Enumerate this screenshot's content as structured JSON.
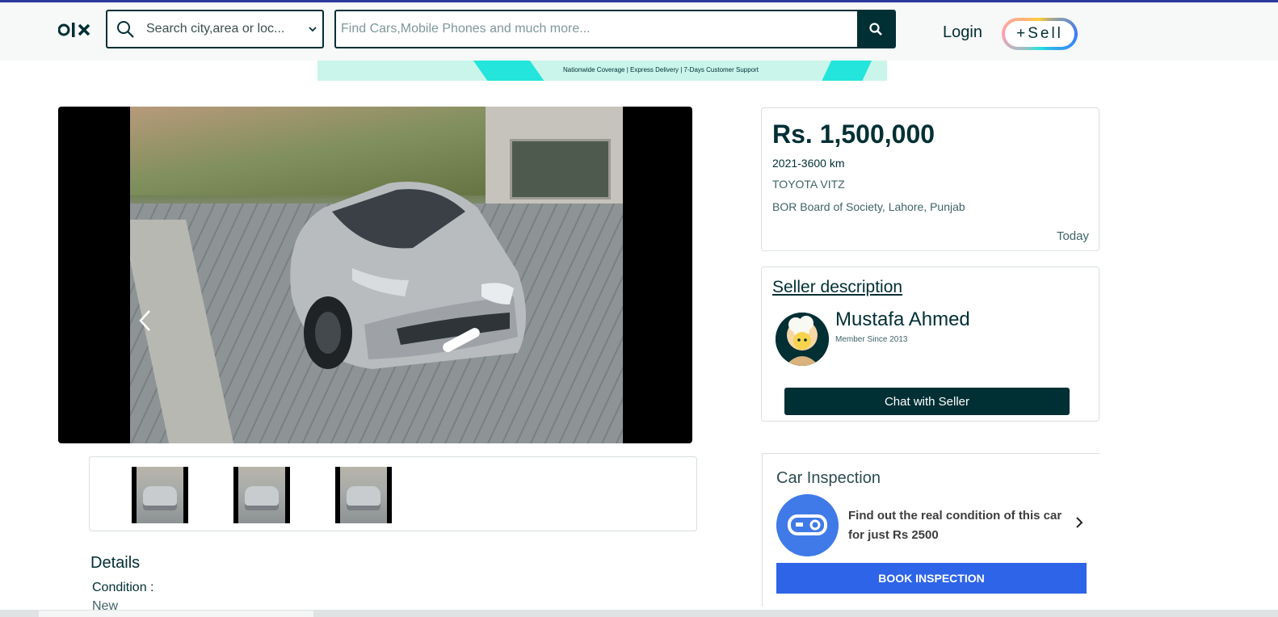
{
  "header": {
    "location_placeholder": "Search city,area or loc...",
    "search_placeholder": "Find Cars,Mobile Phones and much more...",
    "login_label": "Login",
    "sell_label": "+Sell"
  },
  "banner": {
    "text": "Nationwide Coverage   |   Express Delivery   |   7-Days Customer Support"
  },
  "listing": {
    "price": "Rs. 1,500,000",
    "year_km": "2021-3600 km",
    "model": "TOYOTA VITZ",
    "address": "BOR Board of Society, Lahore, Punjab",
    "posted": "Today",
    "photo_count": 3
  },
  "seller": {
    "section_title": "Seller description",
    "name": "Mustafa Ahmed",
    "member_since": "Member Since 2013",
    "chat_label": "Chat with Seller"
  },
  "inspection": {
    "title": "Car Inspection",
    "text": "Find out the real condition of this car for just Rs 2500",
    "button_label": "BOOK INSPECTION"
  },
  "details": {
    "title": "Details",
    "condition_label": "Condition :",
    "condition_value": "New"
  },
  "icons": {
    "search": "search-icon",
    "chevron": "chevron-down-icon",
    "prev": "chevron-left-icon",
    "next": "chevron-right-icon"
  },
  "colors": {
    "primary": "#002f34",
    "book_button": "#2e64e7",
    "banner_bg": "#c9f5ea",
    "accent_teal": "#23e5db"
  }
}
